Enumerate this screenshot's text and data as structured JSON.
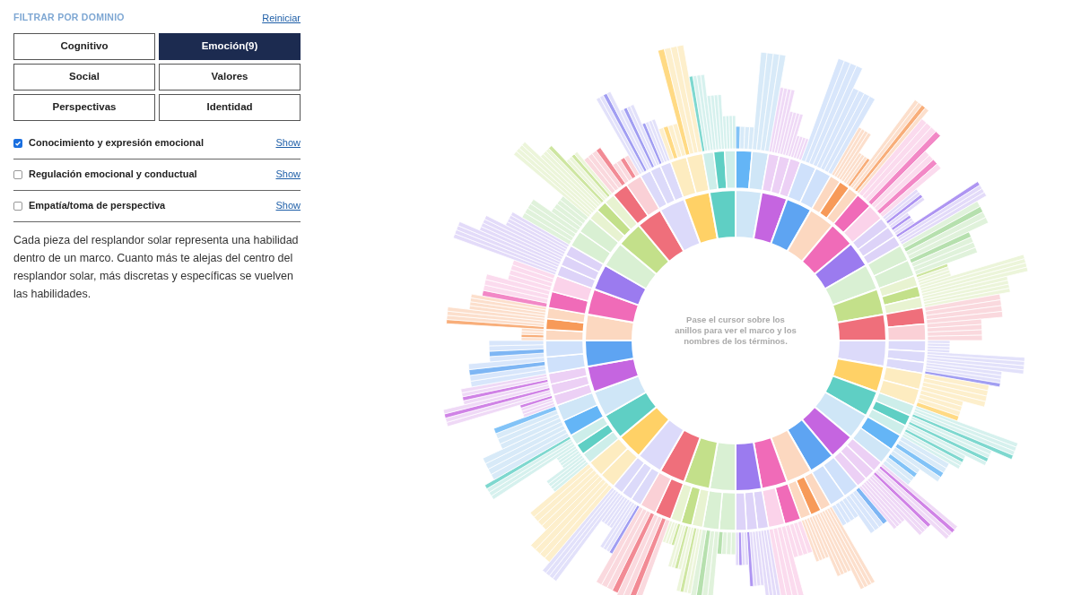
{
  "filter": {
    "title": "FILTRAR POR DOMINIO",
    "reset_link": "Reiniciar"
  },
  "domains": [
    {
      "label": "Cognitivo",
      "selected": false
    },
    {
      "label": "Emoción(9)",
      "selected": true
    },
    {
      "label": "Social",
      "selected": false
    },
    {
      "label": "Valores",
      "selected": false
    },
    {
      "label": "Perspectivas",
      "selected": false
    },
    {
      "label": "Identidad",
      "selected": false
    }
  ],
  "skills": [
    {
      "label": "Conocimiento y expresión emocional",
      "checked": true,
      "link": "Show"
    },
    {
      "label": "Regulación emocional y conductual",
      "checked": false,
      "link": "Show"
    },
    {
      "label": "Empatía/toma de perspectiva",
      "checked": false,
      "link": "Show"
    }
  ],
  "description": "Cada pieza del resplandor solar representa una habilidad dentro de un marco. Cuanto más te alejas del centro del resplandor solar, más discretas y específicas se vuelven las habilidades.",
  "sunburst": {
    "hint": "Pase el cursor sobre los anillos para ver el marco y los nombres de los términos."
  }
}
